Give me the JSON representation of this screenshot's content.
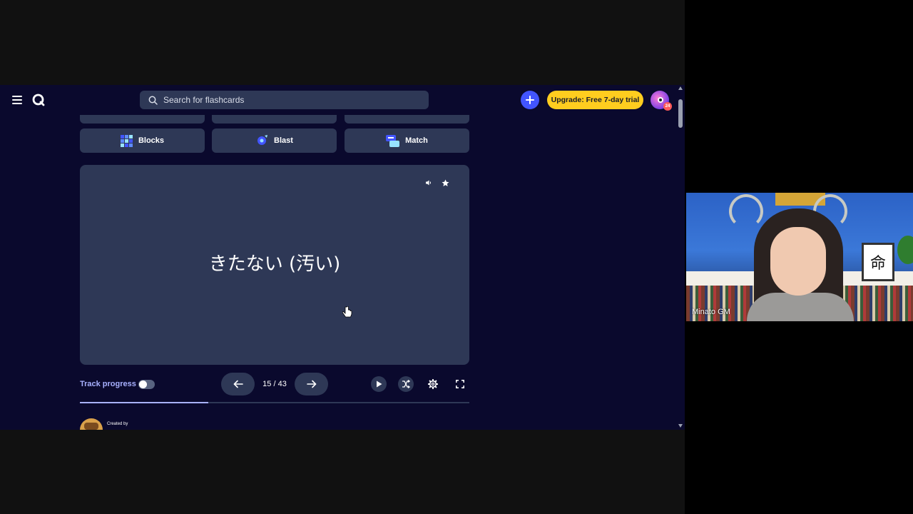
{
  "topbar": {
    "search_placeholder": "Search for flashcards",
    "upgrade_label": "Upgrade: Free 7-day trial",
    "avatar_badge": "24"
  },
  "modes": {
    "row1": [
      "",
      "",
      ""
    ],
    "row2": [
      {
        "label": "Blocks",
        "icon": "blocks-icon"
      },
      {
        "label": "Blast",
        "icon": "blast-icon"
      },
      {
        "label": "Match",
        "icon": "match-icon"
      }
    ]
  },
  "card": {
    "term": "きたない (汚い)"
  },
  "controls": {
    "track_progress_label": "Track progress",
    "counter": "15 / 43",
    "progress_fraction": 0.33
  },
  "creator": {
    "created_by_label": "Created by"
  },
  "webcam": {
    "participant_name": "Minato GM",
    "frame_char": "命"
  },
  "colors": {
    "background": "#0a092d",
    "card": "#2e3856",
    "accent": "#4255ff",
    "upgrade": "#ffcd1f"
  }
}
